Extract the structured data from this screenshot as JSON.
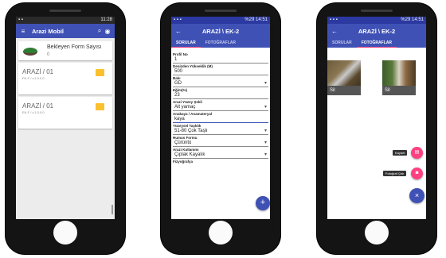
{
  "phone1": {
    "status_time": "11:28",
    "app_title": "Arazi Mobil",
    "form_count_label": "Bekleyen Form Sayısı",
    "form_count_value": "0",
    "items": [
      {
        "title": "ARAZİ / 01",
        "subtitle": "PK-F / v.1.0.0.0"
      },
      {
        "title": "ARAZİ / 01",
        "subtitle": "EK-F / v.1.0.0.0"
      }
    ]
  },
  "phone2": {
    "status_time": "14:51",
    "status_battery": "%29",
    "title": "ARAZİ \\ EK-2",
    "tabs": [
      "SORULAR",
      "FOTOĞRAFLAR"
    ],
    "fields": [
      {
        "label": "Profil No",
        "value": "1"
      },
      {
        "label": "Denizden Yükseklik (M)",
        "value": "500"
      },
      {
        "label": "Bakı",
        "value": "GD"
      },
      {
        "label": "Eğim(%)",
        "value": "23"
      },
      {
        "label": "Arazi Yüzey Şekli",
        "value": "Alt yamaç"
      },
      {
        "label": "Anakaya / Anamateryal",
        "value": "kaya"
      },
      {
        "label": "Yüzeysel Taşlılık",
        "value": "51-80 Çok Taşlı"
      },
      {
        "label": "Humus Formu",
        "value": "Çürüntü"
      },
      {
        "label": "Arazi Kullanımı",
        "value": "Çıplak Kayalık"
      },
      {
        "label": "Fizyoğrafya",
        "value": ""
      }
    ],
    "fab_label": "+"
  },
  "phone3": {
    "status_time": "14:51",
    "status_battery": "%29",
    "title": "ARAZİ \\ EK-2",
    "tabs": [
      "SORULAR",
      "FOTOĞRAFLAR"
    ],
    "photos": [
      {
        "label": "Sil"
      },
      {
        "label": "Sil"
      }
    ],
    "actions": [
      {
        "label": "Kaydet"
      },
      {
        "label": "Fotoğraf Çek"
      }
    ],
    "close_label": "×"
  },
  "colors": {
    "primary": "#3f51b5",
    "accent": "#ff4081",
    "status": "#2a2a2a"
  }
}
